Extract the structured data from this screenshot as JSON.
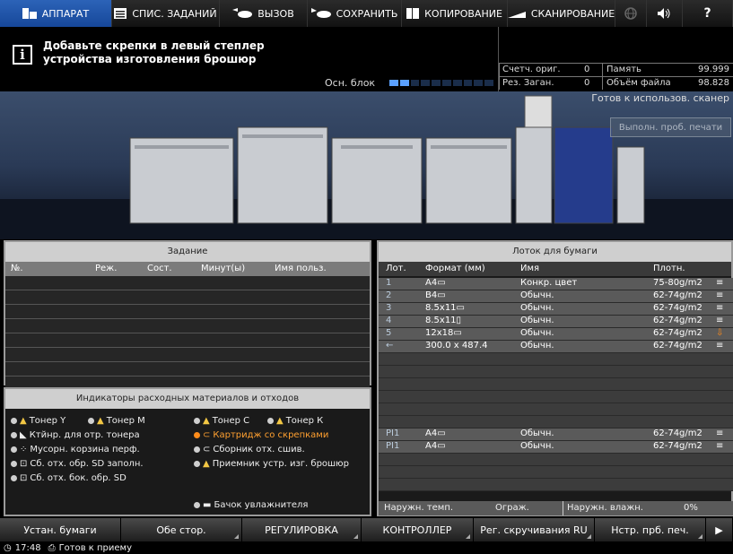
{
  "nav": {
    "machine": "АППАРАТ",
    "job_list": "СПИС. ЗАДАНИЙ",
    "recall": "ВЫЗОВ",
    "save": "СОХРАНИТЬ",
    "copy": "КОПИРОВАНИЕ",
    "scan": "СКАНИРОВАНИЕ",
    "help": "?"
  },
  "message": {
    "line1": "Добавьте скрепки в левый степлер",
    "line2": "устройства изготовления брошюр",
    "main_unit_label": "Осн. блок",
    "main_unit_level": 0.15
  },
  "counters": {
    "orig_label": "Счетч. ориг.",
    "orig_value": "0",
    "memory_label": "Память",
    "memory_value": "99.999",
    "res_label": "Рез. Заган.",
    "res_value": "0",
    "file_label": "Объём файла",
    "file_value": "98.828"
  },
  "status_ready": "Готов к использов. сканер",
  "trial_print_button": "Выполн. проб. печати",
  "job_panel": {
    "title": "Задание",
    "columns": [
      "№.",
      "Реж.",
      "Сост.",
      "Минут(ы)",
      "Имя польз."
    ]
  },
  "consumables": {
    "title": "Индикаторы расходных материалов и отходов",
    "toner_y": "Тонер Y",
    "toner_m": "Тонер М",
    "toner_c": "Тонер С",
    "toner_k": "Тонер К",
    "waste_toner": "Ктйнр. для отр. тонера",
    "punch_box": "Мусорн. корзина перф.",
    "staple_cartridge": "Картридж со скрепками",
    "sd_waste_full": "Сб. отх. обр. SD заполн.",
    "stitch_waste": "Сборник отх. сшив.",
    "sd_side_waste": "Сб. отх. бок. обр. SD",
    "booklet_tray": "Приемник устр. изг. брошюр",
    "humidifier": "Бачок увлажнителя"
  },
  "tray_panel": {
    "title": "Лоток для бумаги",
    "columns": [
      "Лот.",
      "Формат (мм)",
      "Имя",
      "Плотн."
    ],
    "rows": [
      {
        "tray": "1",
        "size": "A4▭",
        "name": "Конкр. цвет",
        "weight": "75-80g/m2"
      },
      {
        "tray": "2",
        "size": "B4▭",
        "name": "Обычн.",
        "weight": "62-74g/m2"
      },
      {
        "tray": "3",
        "size": "8.5x11▭",
        "name": "Обычн.",
        "weight": "62-74g/m2"
      },
      {
        "tray": "4",
        "size": "8.5x11▯",
        "name": "Обычн.",
        "weight": "62-74g/m2"
      },
      {
        "tray": "5",
        "size": "12x18▭",
        "name": "Обычн.",
        "weight": "62-74g/m2"
      },
      {
        "tray": "←",
        "size": "300.0 x 487.4",
        "name": "Обычн.",
        "weight": "62-74g/m2"
      }
    ],
    "pi_rows": [
      {
        "tray": "PI1",
        "size": "A4▭",
        "name": "Обычн.",
        "weight": "62-74g/m2"
      },
      {
        "tray": "PI1",
        "size": "A4▭",
        "name": "Обычн.",
        "weight": "62-74g/m2"
      }
    ],
    "ambient_temp_label": "Наружн. темп.",
    "ambient_temp_value": "Ограж.",
    "ambient_hum_label": "Наружн. влажн.",
    "ambient_hum_value": "0%"
  },
  "bottom": {
    "paper_setting": "Устан. бумаги",
    "duplex": "Обе стор.",
    "adjustment": "РЕГУЛИРОВКА",
    "controller": "КОНТРОЛЛЕР",
    "curl_adjust": "Рег. скручивания RU",
    "trial_setting": "Нстр. прб. печ.",
    "next": "▶"
  },
  "statusbar": {
    "time": "17:48",
    "state": "Готов к приему"
  },
  "colors": {
    "accent": "#1d54a8",
    "warning": "#ff8c1a"
  }
}
